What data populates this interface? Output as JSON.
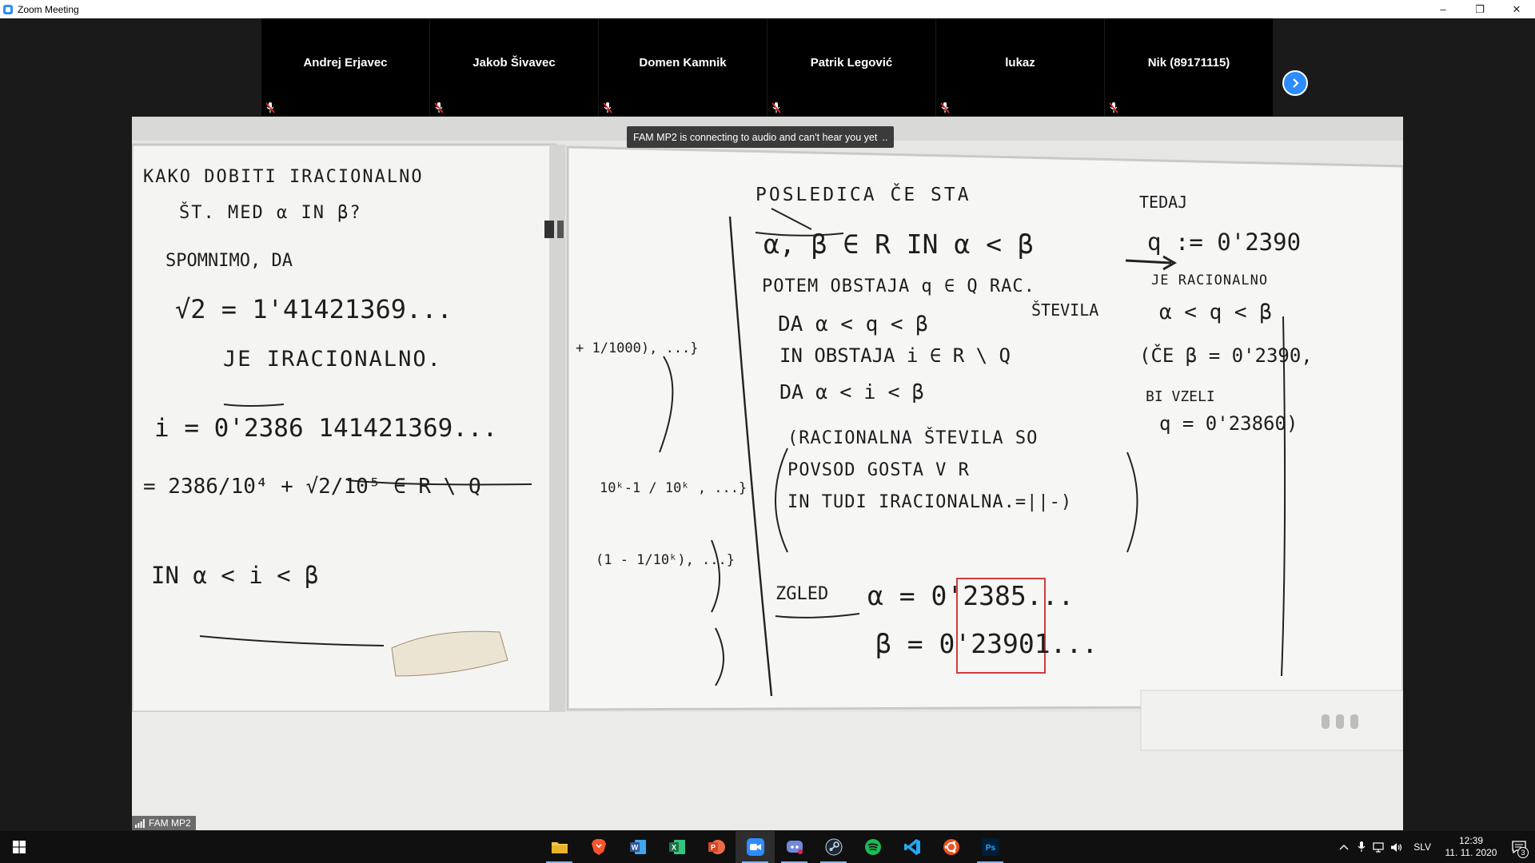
{
  "window": {
    "title": "Zoom Meeting",
    "minimize": "–",
    "restore": "❐",
    "close": "✕"
  },
  "participants": [
    {
      "name": "Andrej Erjavec",
      "muted": true
    },
    {
      "name": "Jakob Šivavec",
      "muted": true
    },
    {
      "name": "Domen Kamnik",
      "muted": true
    },
    {
      "name": "Patrik Legović",
      "muted": true
    },
    {
      "name": "lukaz",
      "muted": true
    },
    {
      "name": "Nik (89171115)",
      "muted": true
    }
  ],
  "video": {
    "notice": "FAM MP2 is connecting to audio and can't hear you yet",
    "speaker_name": "FAM MP2"
  },
  "whiteboard": {
    "left": {
      "lines": [
        "KAKO DOBITI IRACIONALNO",
        "ŠT. MED α IN β?",
        "SPOMNIMO, DA",
        "√2 = 1'41421369...",
        "JE IRACIONALNO.",
        "i = 0'2386 141421369...",
        "= 2386/10⁴ + √2/10⁵ ∈ R \\ Q",
        "IN α < i < β"
      ]
    },
    "middle": {
      "lines": [
        "+ 1/1000), ...}",
        "10ᵏ-1 / 10ᵏ , ...}",
        "(1 - 1/10ᵏ), ...}"
      ]
    },
    "right": {
      "heading": "POSLEDICA ČE STA",
      "lines": [
        "α, β ∈ R IN α < β",
        "POTEM OBSTAJA q ∈ Q RAC.",
        "DA α < q < β",
        "ŠTEVILA",
        "IN OBSTAJA i ∈ R \\ Q",
        "DA α < i < β",
        "(RACIONALNA ŠTEVILA SO",
        "POVSOD GOSTA V R",
        "IN TUDI IRACIONALNA.=||-)"
      ],
      "example_label": "ZGLED",
      "alpha": "α = 0'2385...",
      "beta": "β = 0'23901...",
      "alpha_prefix": "0'23",
      "alpha_rest": "85...",
      "beta_prefix": "0'23",
      "beta_rest": "901...",
      "far_right": [
        "TEDAJ",
        "q := 0'2390",
        "JE RACIONALNO",
        "α < q < β",
        "(ČE β = 0'2390,",
        "BI VZELI",
        "q = 0'23860)"
      ]
    }
  },
  "taskbar": {
    "apps": [
      {
        "name": "File Explorer",
        "icon": "folder-icon",
        "color": "#f2c744"
      },
      {
        "name": "Brave",
        "icon": "brave-icon",
        "color": "#fb542b"
      },
      {
        "name": "Word",
        "icon": "word-icon",
        "color": "#2b5797"
      },
      {
        "name": "Excel",
        "icon": "excel-icon",
        "color": "#1e7145"
      },
      {
        "name": "PowerPoint",
        "icon": "powerpoint-icon",
        "color": "#d24726"
      },
      {
        "name": "Zoom",
        "icon": "zoom-icon",
        "color": "#2d8cff"
      },
      {
        "name": "Discord",
        "icon": "discord-icon",
        "color": "#7289da"
      },
      {
        "name": "Steam",
        "icon": "steam-icon",
        "color": "#1b2838"
      },
      {
        "name": "Spotify",
        "icon": "spotify-icon",
        "color": "#1db954"
      },
      {
        "name": "Visual Studio Code",
        "icon": "vscode-icon",
        "color": "#23a9f2"
      },
      {
        "name": "Ubuntu",
        "icon": "ubuntu-icon",
        "color": "#e95420"
      },
      {
        "name": "Photoshop",
        "icon": "photoshop-icon",
        "color": "#31a8ff"
      }
    ],
    "tray": {
      "chevron": "^",
      "language": "SLV",
      "time": "12:39",
      "date": "11. 11. 2020",
      "notifications": "3"
    }
  }
}
